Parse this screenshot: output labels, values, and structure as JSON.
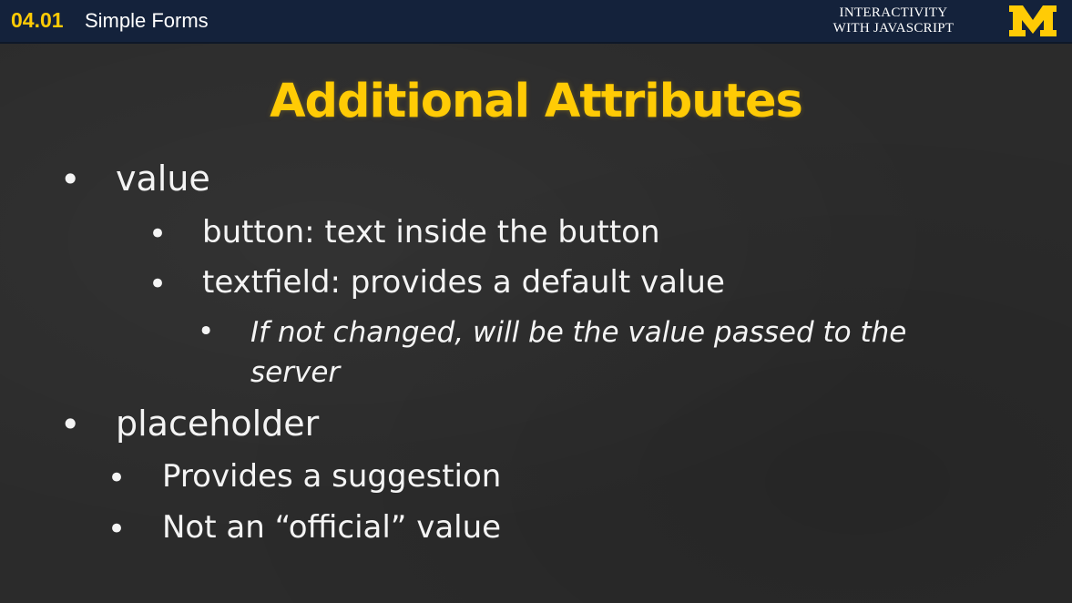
{
  "header": {
    "lesson_number": "04.01",
    "lesson_title": "Simple Forms",
    "course_line1": "INTERACTIVITY",
    "course_line2": "WITH JAVASCRIPT",
    "logo_letter": "M"
  },
  "slide": {
    "title": "Additional Attributes",
    "bullets": [
      {
        "text": "value",
        "level": 1
      },
      {
        "text": "button: text inside the button",
        "level": 2
      },
      {
        "text": "textfield: provides a default value",
        "level": 2
      },
      {
        "text": "If not changed, will be the value passed to the server",
        "level": 3
      },
      {
        "text": "placeholder",
        "level": 1
      },
      {
        "text": "Provides a suggestion",
        "level": 2
      },
      {
        "text": "Not an “official” value",
        "level": 2
      }
    ],
    "bullet_glyph": "•"
  },
  "colors": {
    "header_bg": "#14223b",
    "accent_maize": "#ffcb05",
    "slide_bg": "#2b2b2b",
    "text": "#f4f4f4"
  }
}
